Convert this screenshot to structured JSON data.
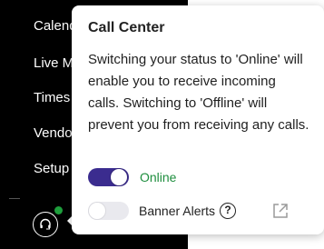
{
  "sidebar": {
    "items": [
      {
        "label": "Calend"
      },
      {
        "label": "Live M"
      },
      {
        "label": "Times"
      },
      {
        "label": "Vendo"
      },
      {
        "label": "Setup"
      }
    ],
    "headset_icon": "headset-icon",
    "status_color": "#1e9e3c"
  },
  "popover": {
    "title": "Call Center",
    "body": "Switching your status to 'Online' will enable you to receive incoming calls. Switching to 'Offline' will prevent you from receiving any calls.",
    "status_toggle": {
      "label": "Online",
      "on": true,
      "color": "#3b2c8f"
    },
    "banner_toggle": {
      "label": "Banner Alerts",
      "on": false
    },
    "help_icon": "question-circle-icon",
    "help_glyph": "?",
    "external_icon": "external-link-icon"
  }
}
